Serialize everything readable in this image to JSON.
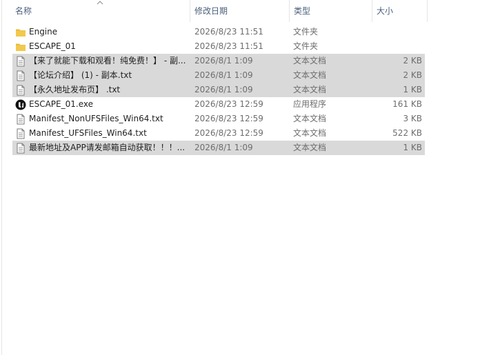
{
  "columns": {
    "name": "名称",
    "modified": "修改日期",
    "type": "类型",
    "size": "大小"
  },
  "files": [
    {
      "name": "Engine",
      "modified": "2026/8/23 11:51",
      "type": "文件夹",
      "size": "",
      "icon": "folder-icon",
      "selected": false
    },
    {
      "name": "ESCAPE_01",
      "modified": "2026/8/23 11:51",
      "type": "文件夹",
      "size": "",
      "icon": "folder-icon",
      "selected": false
    },
    {
      "name": "【来了就能下载和观看！纯免费！】 - 副...",
      "modified": "2026/8/1 1:09",
      "type": "文本文档",
      "size": "2 KB",
      "icon": "text-file-icon",
      "selected": true
    },
    {
      "name": "【论坛介绍】 (1) - 副本.txt",
      "modified": "2026/8/1 1:09",
      "type": "文本文档",
      "size": "2 KB",
      "icon": "text-file-icon",
      "selected": true
    },
    {
      "name": "【永久地址发布页】 .txt",
      "modified": "2026/8/1 1:09",
      "type": "文本文档",
      "size": "1 KB",
      "icon": "text-file-icon",
      "selected": true
    },
    {
      "name": "ESCAPE_01.exe",
      "modified": "2026/8/23 12:59",
      "type": "应用程序",
      "size": "161 KB",
      "icon": "unreal-engine-icon",
      "selected": false
    },
    {
      "name": "Manifest_NonUFSFiles_Win64.txt",
      "modified": "2026/8/23 12:59",
      "type": "文本文档",
      "size": "3 KB",
      "icon": "text-file-icon",
      "selected": false
    },
    {
      "name": "Manifest_UFSFiles_Win64.txt",
      "modified": "2026/8/23 12:59",
      "type": "文本文档",
      "size": "522 KB",
      "icon": "text-file-icon",
      "selected": false
    },
    {
      "name": "最新地址及APP请发邮箱自动获取！！！...",
      "modified": "2026/8/1 1:09",
      "type": "文本文档",
      "size": "1 KB",
      "icon": "text-file-icon",
      "selected": true
    }
  ],
  "colors": {
    "selected_row": "#d9d9d9",
    "folder_yellow": "#f2c94c",
    "header_text": "#4c607a"
  }
}
